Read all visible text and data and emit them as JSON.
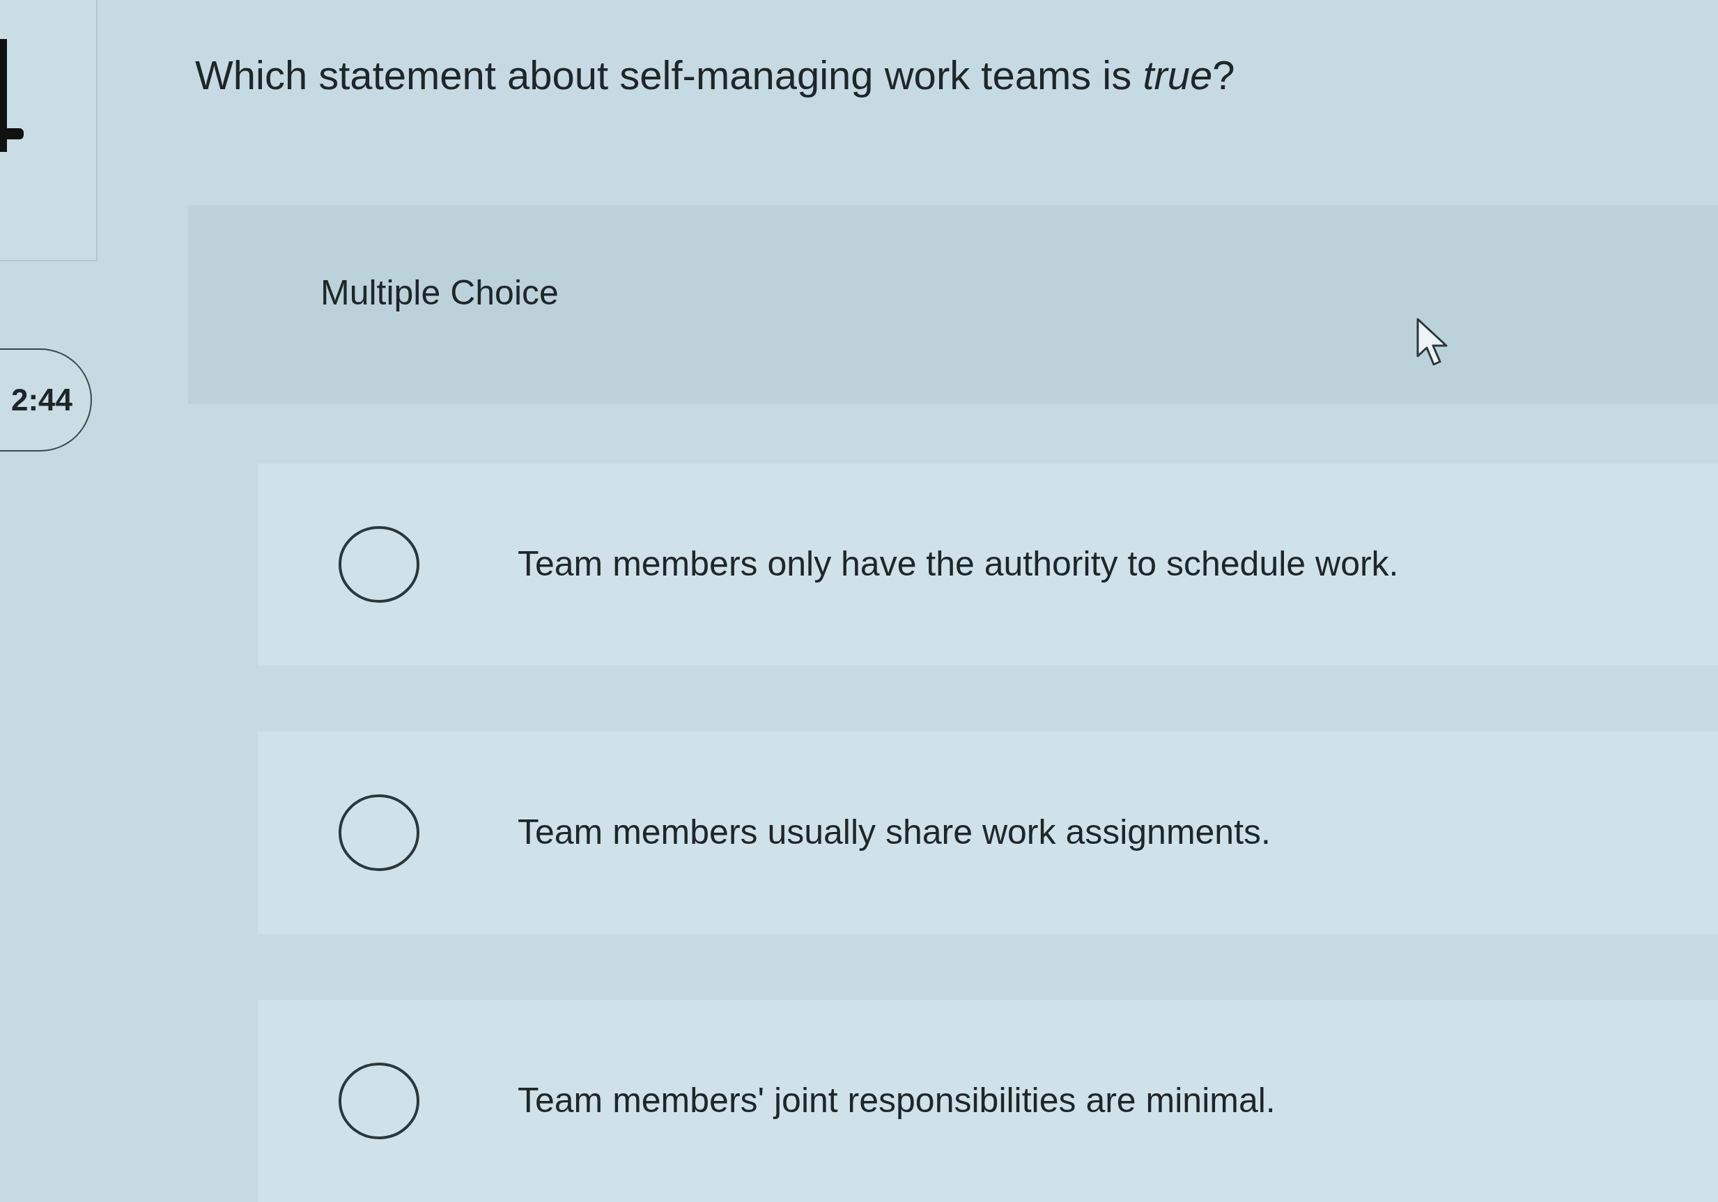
{
  "timer": {
    "text": "2:44"
  },
  "question": {
    "text": "Which statement about self-managing work teams is *true*?"
  },
  "question_type": {
    "label": "Multiple Choice"
  },
  "options": [
    {
      "text": "Team members only have the authority to schedule work.",
      "selected": false
    },
    {
      "text": "Team members usually share work assignments.",
      "selected": false
    },
    {
      "text": "Team members' joint responsibilities are minimal.",
      "selected": false
    }
  ]
}
